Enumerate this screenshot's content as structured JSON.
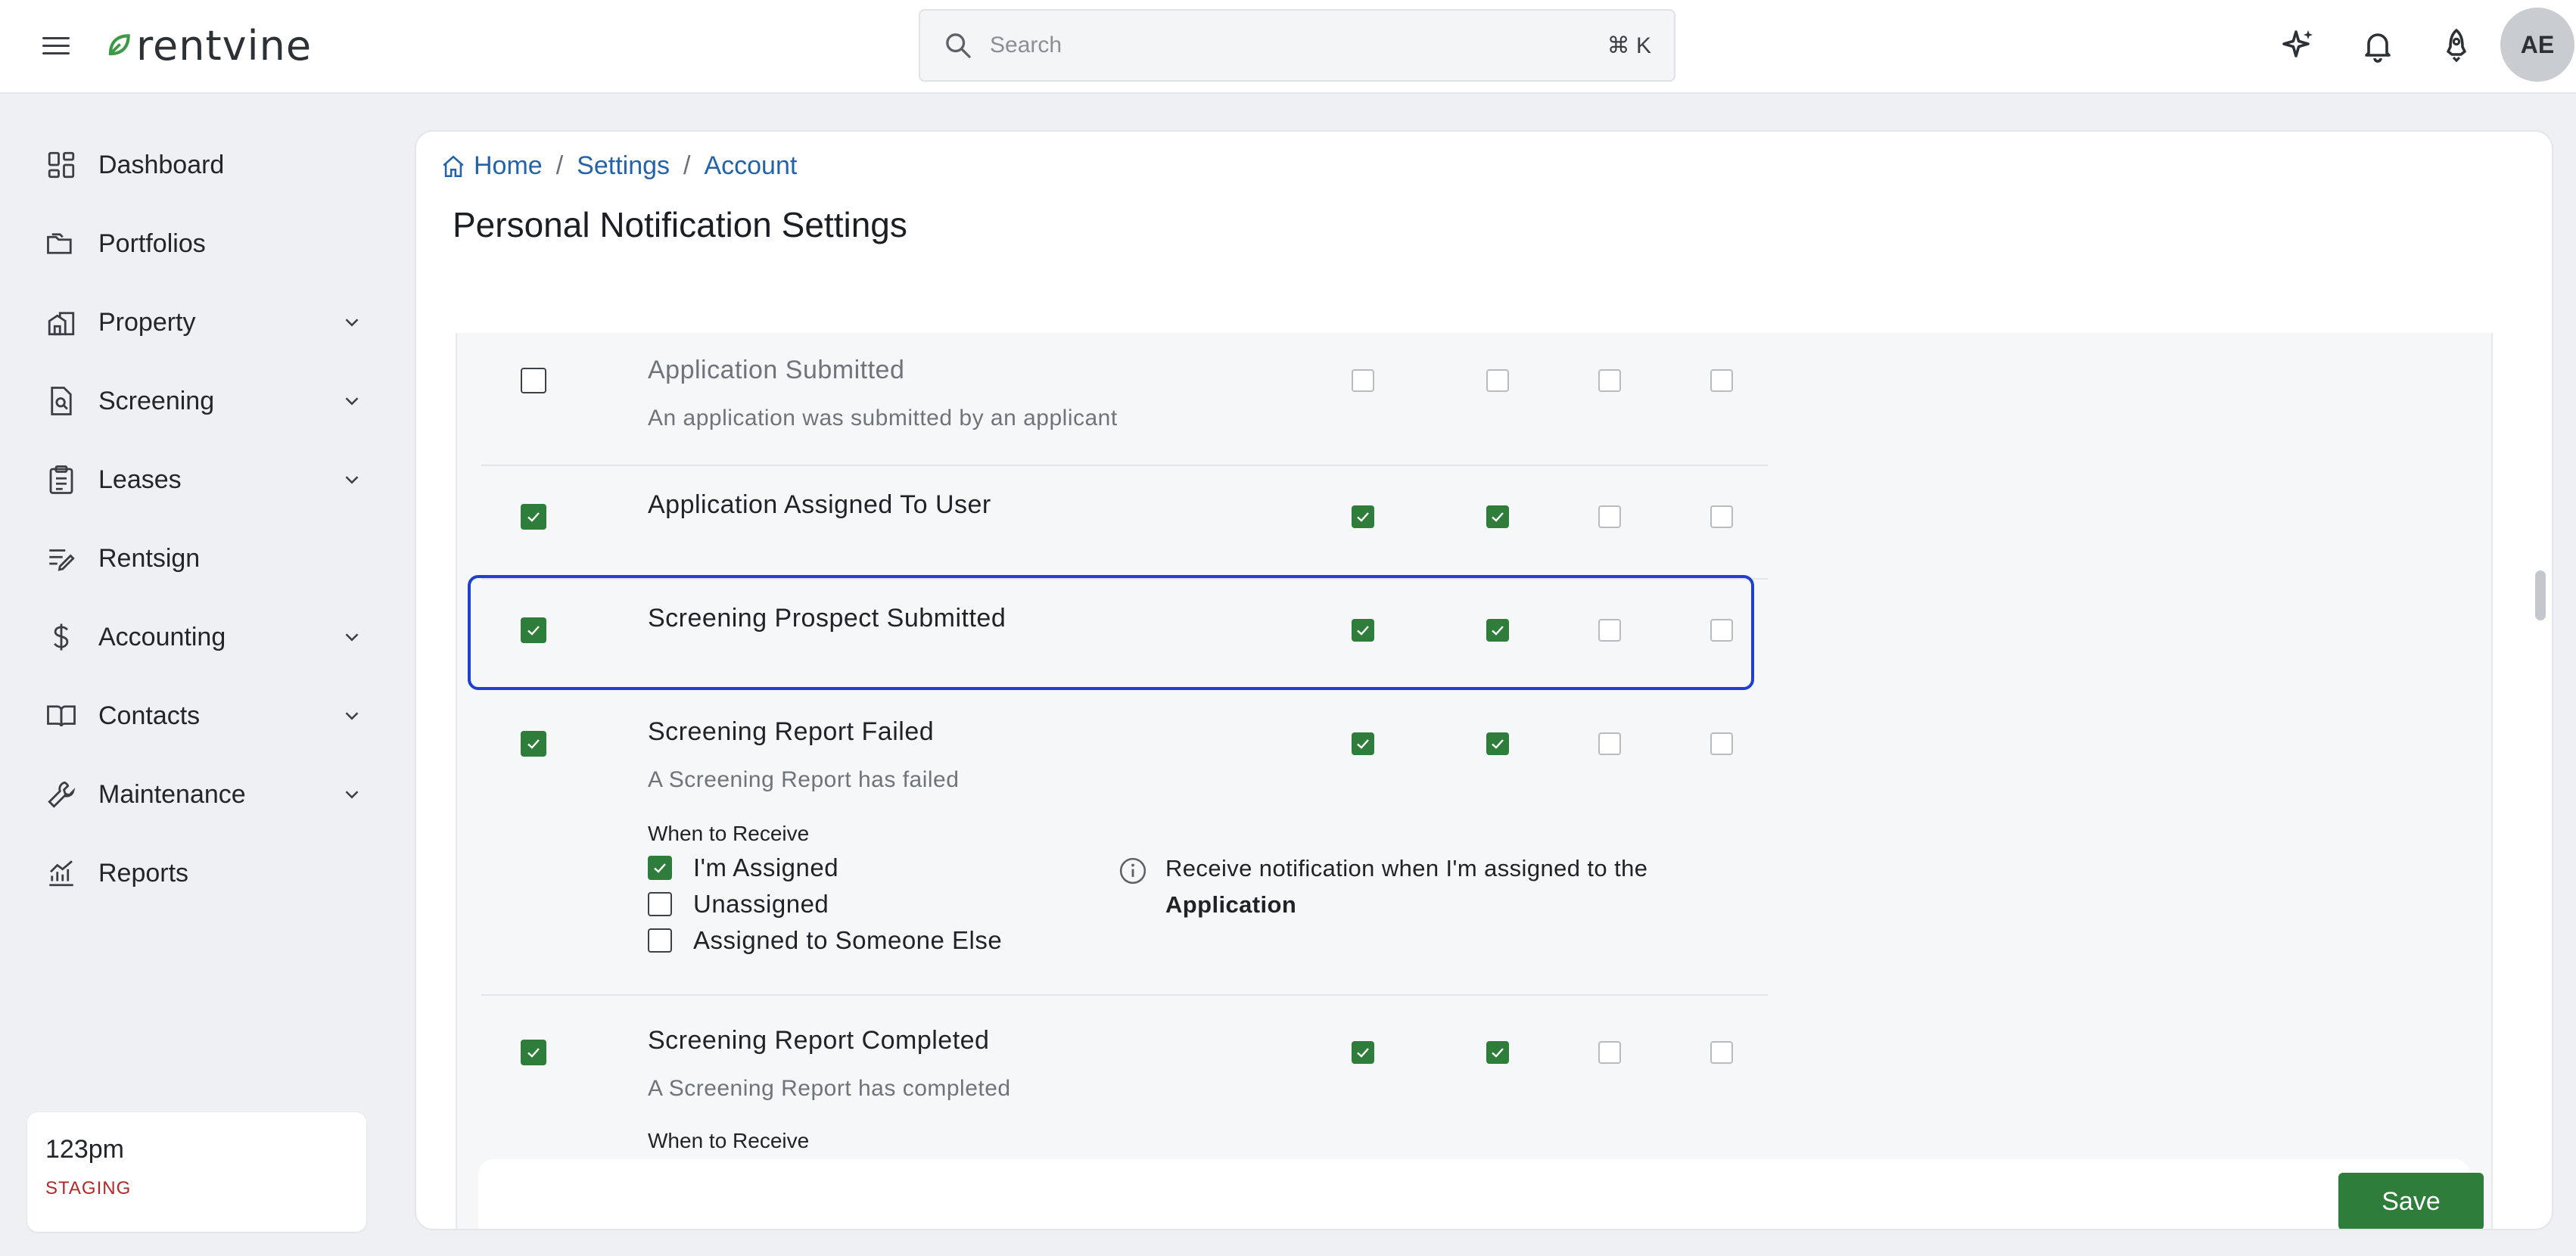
{
  "app": {
    "brand": "rentvine",
    "brand_color": "#2f7d3a"
  },
  "search": {
    "placeholder": "Search",
    "shortcut": "⌘ K"
  },
  "user": {
    "initials": "AE"
  },
  "sidebar": {
    "items": [
      {
        "label": "Dashboard",
        "icon": "dashboard-icon",
        "has_chevron": false
      },
      {
        "label": "Portfolios",
        "icon": "folder-icon",
        "has_chevron": false
      },
      {
        "label": "Property",
        "icon": "building-icon",
        "has_chevron": true
      },
      {
        "label": "Screening",
        "icon": "screening-icon",
        "has_chevron": true
      },
      {
        "label": "Leases",
        "icon": "clipboard-icon",
        "has_chevron": true
      },
      {
        "label": "Rentsign",
        "icon": "signature-icon",
        "has_chevron": false
      },
      {
        "label": "Accounting",
        "icon": "dollar-icon",
        "has_chevron": true
      },
      {
        "label": "Contacts",
        "icon": "book-icon",
        "has_chevron": true
      },
      {
        "label": "Maintenance",
        "icon": "wrench-icon",
        "has_chevron": true
      },
      {
        "label": "Reports",
        "icon": "chart-icon",
        "has_chevron": false
      }
    ],
    "environment": {
      "name": "123pm",
      "tag": "STAGING"
    }
  },
  "breadcrumb": {
    "home": "Home",
    "settings": "Settings",
    "account": "Account",
    "separator": "/"
  },
  "page": {
    "title": "Personal Notification Settings"
  },
  "rows": [
    {
      "title": "Application Submitted",
      "description": "An application was submitted by an applicant",
      "enabled": false,
      "channels": [
        false,
        false,
        false,
        false
      ],
      "muted": true
    },
    {
      "title": "Application Assigned To User",
      "description": "",
      "enabled": true,
      "channels": [
        true,
        true,
        false,
        false
      ]
    },
    {
      "title": "Screening Prospect Submitted",
      "description": "",
      "enabled": true,
      "channels": [
        true,
        true,
        false,
        false
      ],
      "highlighted": true
    },
    {
      "title": "Screening Report Failed",
      "description": "A Screening Report has failed",
      "enabled": true,
      "channels": [
        true,
        true,
        false,
        false
      ],
      "when_to_receive": {
        "label": "When to Receive",
        "options": [
          {
            "label": "I'm Assigned",
            "checked": true
          },
          {
            "label": "Unassigned",
            "checked": false
          },
          {
            "label": "Assigned to Someone Else",
            "checked": false
          }
        ],
        "info_text": "Receive notification when I'm assigned to the",
        "info_bold": "Application"
      }
    },
    {
      "title": "Screening Report Completed",
      "description": "A Screening Report has completed",
      "enabled": true,
      "channels": [
        true,
        true,
        false,
        false
      ],
      "when_to_receive": {
        "label": "When to Receive"
      }
    }
  ],
  "footer": {
    "save_label": "Save"
  }
}
